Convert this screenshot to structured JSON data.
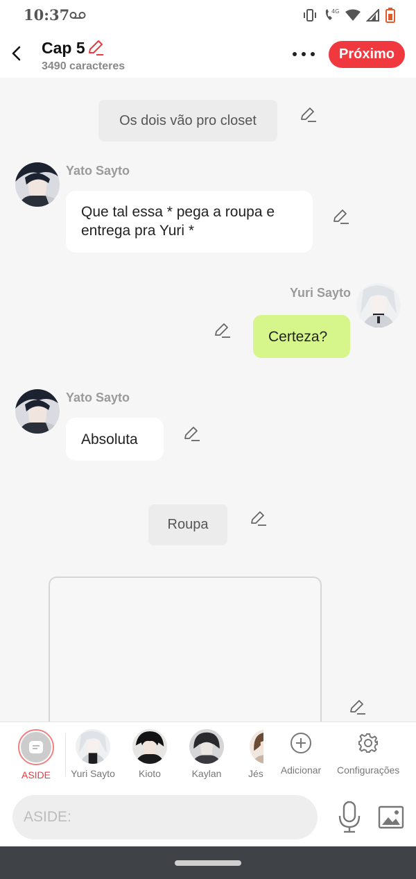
{
  "status_bar": {
    "time": "10:37",
    "network_label": "4G"
  },
  "header": {
    "title": "Cap 5",
    "subtitle": "3490 caracteres",
    "next_label": "Próximo"
  },
  "messages": [
    {
      "type": "narration",
      "text": "Os dois vão pro closet"
    },
    {
      "type": "character",
      "side": "left",
      "name": "Yato Sayto",
      "text": "Que tal essa * pega a roupa e entrega pra Yuri *"
    },
    {
      "type": "character",
      "side": "right",
      "name": "Yuri Sayto",
      "text": "Certeza?"
    },
    {
      "type": "character",
      "side": "left",
      "name": "Yato Sayto",
      "text": "Absoluta"
    },
    {
      "type": "narration",
      "text": "Roupa"
    }
  ],
  "character_bar": {
    "items": [
      {
        "label": "ASIDE"
      },
      {
        "label": "Yuri Sayto"
      },
      {
        "label": "Kioto"
      },
      {
        "label": "Kaylan"
      },
      {
        "label": "Jés"
      }
    ],
    "add_label": "Adicionar",
    "settings_label": "Configurações"
  },
  "input": {
    "placeholder": "ASIDE:"
  },
  "colors": {
    "accent": "#f0383f",
    "right_bubble": "#d6f58a",
    "narration_bubble": "#ececec"
  }
}
